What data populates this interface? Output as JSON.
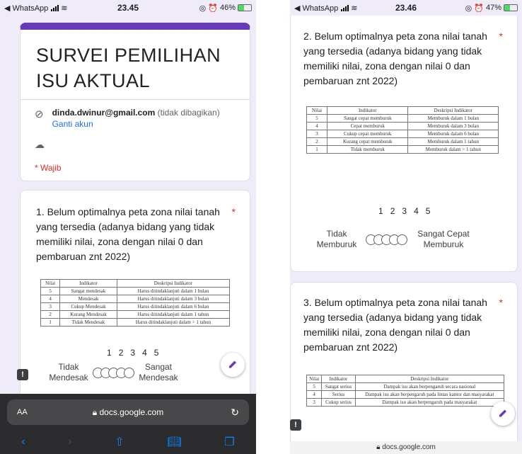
{
  "left": {
    "status": {
      "back": "◀ WhatsApp",
      "time": "23.45",
      "battery_text": "46%",
      "battery_level": 0.46
    },
    "form": {
      "title": "SURVEI PEMILIHAN ISU AKTUAL",
      "email": "dinda.dwinur@gmail.com",
      "email_note": "(tidak dibagikan)",
      "switch_account": "Ganti akun",
      "required": "* Wajib"
    },
    "question": {
      "text": "1. Belum optimalnya peta zona nilai tanah yang tersedia (adanya bidang yang tidak memiliki nilai, zona dengan nilai 0 dan pembaruan znt 2022)",
      "star": "*",
      "table": {
        "headers": [
          "Nilai",
          "Indikator",
          "Deskripsi Indikator"
        ],
        "rows": [
          [
            "5",
            "Sangat mendesak",
            "Harus ditindaklanjuti dalam 1 bulan"
          ],
          [
            "4",
            "Mendesak",
            "Harus ditindaklanjuti dalam 3 bulan"
          ],
          [
            "3",
            "Cukup Mendesak",
            "Harus ditindaklanjuti dalam 6 bulan"
          ],
          [
            "2",
            "Kurang Mendesak",
            "Harus ditindaklanjuti dalam 1 tahun"
          ],
          [
            "1",
            "Tidak Mendesak",
            "Harus ditindaklanjuti dalam > 1 tahun"
          ]
        ]
      },
      "scale": [
        "1",
        "2",
        "3",
        "4",
        "5"
      ],
      "low_label": "Tidak Mendesak",
      "high_label": "Sangat Mendesak"
    },
    "safari": {
      "aa": "AA",
      "url": "docs.google.com"
    }
  },
  "right": {
    "status": {
      "back": "◀ WhatsApp",
      "time": "23.46",
      "battery_text": "47%",
      "battery_level": 0.47
    },
    "question2": {
      "text": "2. Belum optimalnya peta zona nilai tanah yang tersedia (adanya bidang yang tidak memiliki nilai, zona dengan nilai 0 dan pembaruan znt 2022)",
      "star": "*",
      "table": {
        "headers": [
          "Nilai",
          "Indikator",
          "Deskripsi Indikator"
        ],
        "rows": [
          [
            "5",
            "Sangat cepat memburuk",
            "Memburuk dalam 1 bulan"
          ],
          [
            "4",
            "Cepat memburuk",
            "Memburuk dalam 3 bulan"
          ],
          [
            "3",
            "Cukup cepat memburuk",
            "Memburuk dalam 6 bulan"
          ],
          [
            "2",
            "Kurang cepat memburuk",
            "Memburuk dalam 1 tahun"
          ],
          [
            "1",
            "Tidak memburuk",
            "Memburuk dalam > 1 tahun"
          ]
        ]
      },
      "scale": [
        "1",
        "2",
        "3",
        "4",
        "5"
      ],
      "low_label": "Tidak Memburuk",
      "high_label": "Sangat Cepat Memburuk"
    },
    "question3": {
      "text": "3. Belum optimalnya peta zona nilai tanah yang tersedia (adanya bidang yang tidak memiliki nilai, zona dengan nilai 0 dan pembaruan znt 2022)",
      "star": "*",
      "table": {
        "headers": [
          "Nilai",
          "Indikator",
          "Deskripsi Indikator"
        ],
        "rows": [
          [
            "5",
            "Sangat serius",
            "Dampak isu akan berpengaruh secara nasional"
          ],
          [
            "4",
            "Serius",
            "Dampak isu akan berpengaruh pada lintas kantor dan masyarakat"
          ],
          [
            "3",
            "Cukup serius",
            "Dampak isu akan berpengaruh pada masyarakat"
          ]
        ]
      }
    },
    "bottom_url": "docs.google.com"
  },
  "colors": {
    "accent": "#673ab7",
    "required": "#d93025",
    "link": "#1a73e8",
    "background": "#f0ebf8"
  }
}
